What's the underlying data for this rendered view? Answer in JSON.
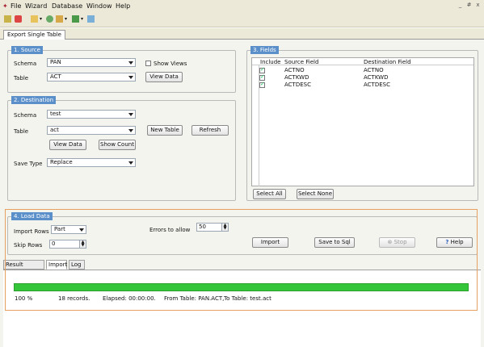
{
  "menu": {
    "file": "File",
    "wizard": "Wizard",
    "database": "Database",
    "window": "Window",
    "help": "Help"
  },
  "window_buttons": {
    "minimize": "_",
    "restore": "#",
    "close": "x"
  },
  "document_tab": "Export Single Table",
  "source": {
    "legend": "1. Source",
    "schema_label": "Schema",
    "schema_value": "PAN",
    "show_views_label": "Show Views",
    "table_label": "Table",
    "table_value": "ACT",
    "view_data": "View Data"
  },
  "destination": {
    "legend": "2. Destination",
    "schema_label": "Schema",
    "schema_value": "test",
    "table_label": "Table",
    "table_value": "act",
    "new_table": "New Table",
    "refresh": "Refresh",
    "view_data": "View Data",
    "show_count": "Show Count",
    "save_type_label": "Save Type",
    "save_type_value": "Replace"
  },
  "fields": {
    "legend": "3. Fields",
    "headers": {
      "include": "Include",
      "source": "Source Field",
      "dest": "Destination Field"
    },
    "rows": [
      {
        "include": true,
        "source": "ACTNO",
        "dest": "ACTNO"
      },
      {
        "include": true,
        "source": "ACTKWD",
        "dest": "ACTKWD"
      },
      {
        "include": true,
        "source": "ACTDESC",
        "dest": "ACTDESC"
      }
    ],
    "select_all": "Select All",
    "select_none": "Select None"
  },
  "load": {
    "legend": "4. Load Data",
    "import_rows_label": "Import Rows",
    "import_rows_value": "Part",
    "skip_rows_label": "Skip Rows",
    "skip_rows_value": "0",
    "errors_label": "Errors to allow",
    "errors_value": "50",
    "import": "Import",
    "save_to_sql": "Save to Sql",
    "stop": "Stop",
    "help": "Help"
  },
  "result_tabs": [
    "Result Preview",
    "Import",
    "Log"
  ],
  "status": {
    "percent": "100 %",
    "progress_fraction": 1.0,
    "records": "18 records.",
    "elapsed": "Elapsed: 00:00:00.",
    "from": "From Table: PAN.ACT,",
    "to": "To Table: test.act"
  },
  "colors": {
    "progress": "#35c53a",
    "legend_bg": "#5b8fc9",
    "highlight": "#e8a060"
  }
}
